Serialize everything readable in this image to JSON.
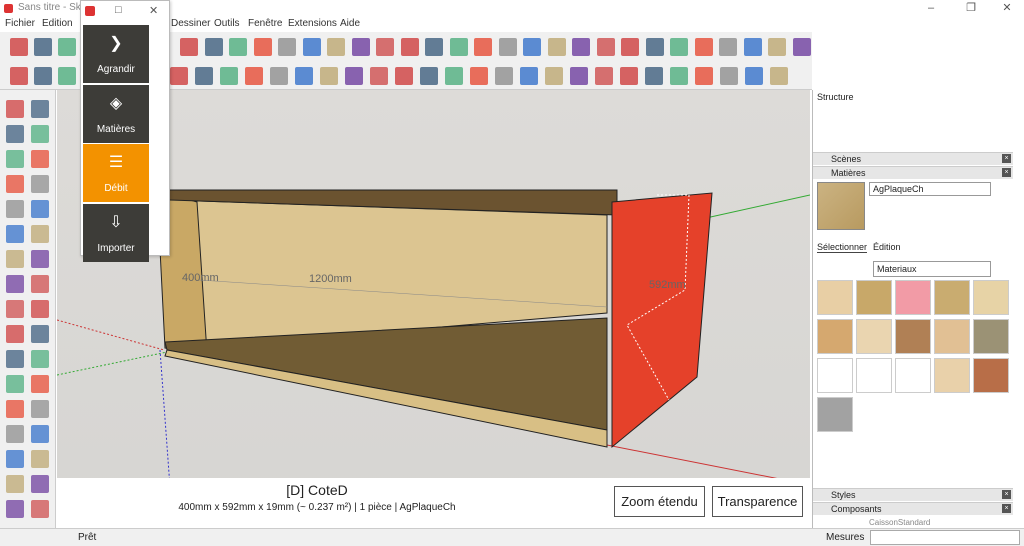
{
  "window": {
    "title": "Sans titre - Sketc",
    "controls": [
      "–",
      "❐",
      "✕"
    ]
  },
  "menus": [
    "Fichier",
    "Edition",
    "Dessiner",
    "Outils",
    "Fenêtre",
    "Extensions",
    "Aide"
  ],
  "popup": {
    "items": [
      {
        "label": "Agrandir",
        "icon": "chevron-right-icon"
      },
      {
        "label": "Matières",
        "icon": "paint-bucket-icon"
      },
      {
        "label": "Débit",
        "icon": "list-icon"
      },
      {
        "label": "Importer",
        "icon": "import-icon"
      }
    ],
    "active": "Débit",
    "accent": "#f39200"
  },
  "dimensions": {
    "width": "400mm",
    "length": "1200mm",
    "depth": "592mm"
  },
  "info": {
    "title": "[D] CoteD",
    "details": "400mm x 592mm x 19mm (~ 0.237 m²) | 1 pièce | AgPlaqueCh"
  },
  "buttons": {
    "zoom": "Zoom étendu",
    "transparence": "Transparence"
  },
  "status": {
    "text": "Prêt",
    "measure_label": "Mesures"
  },
  "tray": {
    "structure": "Structure",
    "scenes": "Scènes",
    "matieres": "Matières",
    "material_name": "AgPlaqueCh",
    "tab_select": "Sélectionner",
    "tab_edit": "Édition",
    "library": "Materiaux",
    "styles": "Styles",
    "composants": "Composants",
    "component_item": "CaissonStandard"
  },
  "swatches": [
    "#e8cfa5",
    "#c8a869",
    "#f29ba6",
    "#c9ac70",
    "#e7d3a6",
    "#d5a86f",
    "#ead5b0",
    "#b08055",
    "#e1c094",
    "#9b9275",
    "#ffffff",
    "#ffffff",
    "#ffffff",
    "#e9d1aa",
    "#b86e48",
    "#a2a2a2"
  ]
}
